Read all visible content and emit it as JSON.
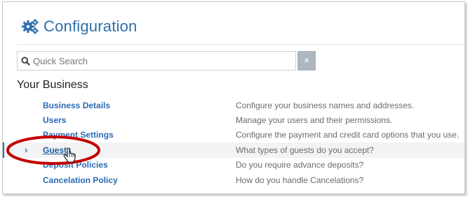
{
  "header": {
    "title": "Configuration",
    "icon": "gears-icon",
    "accent_color": "#2f6fad"
  },
  "search": {
    "placeholder": "Quick Search",
    "value": "",
    "clear_label": "×"
  },
  "section": {
    "title": "Your Business"
  },
  "items": [
    {
      "label": "Business Details",
      "description": "Configure your business names and addresses."
    },
    {
      "label": "Users",
      "description": "Manage your users and their permissions."
    },
    {
      "label": "Payment Settings",
      "description": "Configure the payment and credit card options that you use."
    },
    {
      "label": "Guests",
      "description": "What types of guests do you accept?",
      "active": true,
      "chevron": "›"
    },
    {
      "label": "Deposit Policies",
      "description": "Do you require advance deposits?"
    },
    {
      "label": "Cancelation Policy",
      "description": "How do you handle Cancelations?"
    }
  ],
  "annotation": {
    "type": "red-ellipse-highlight",
    "color": "#c40000"
  }
}
